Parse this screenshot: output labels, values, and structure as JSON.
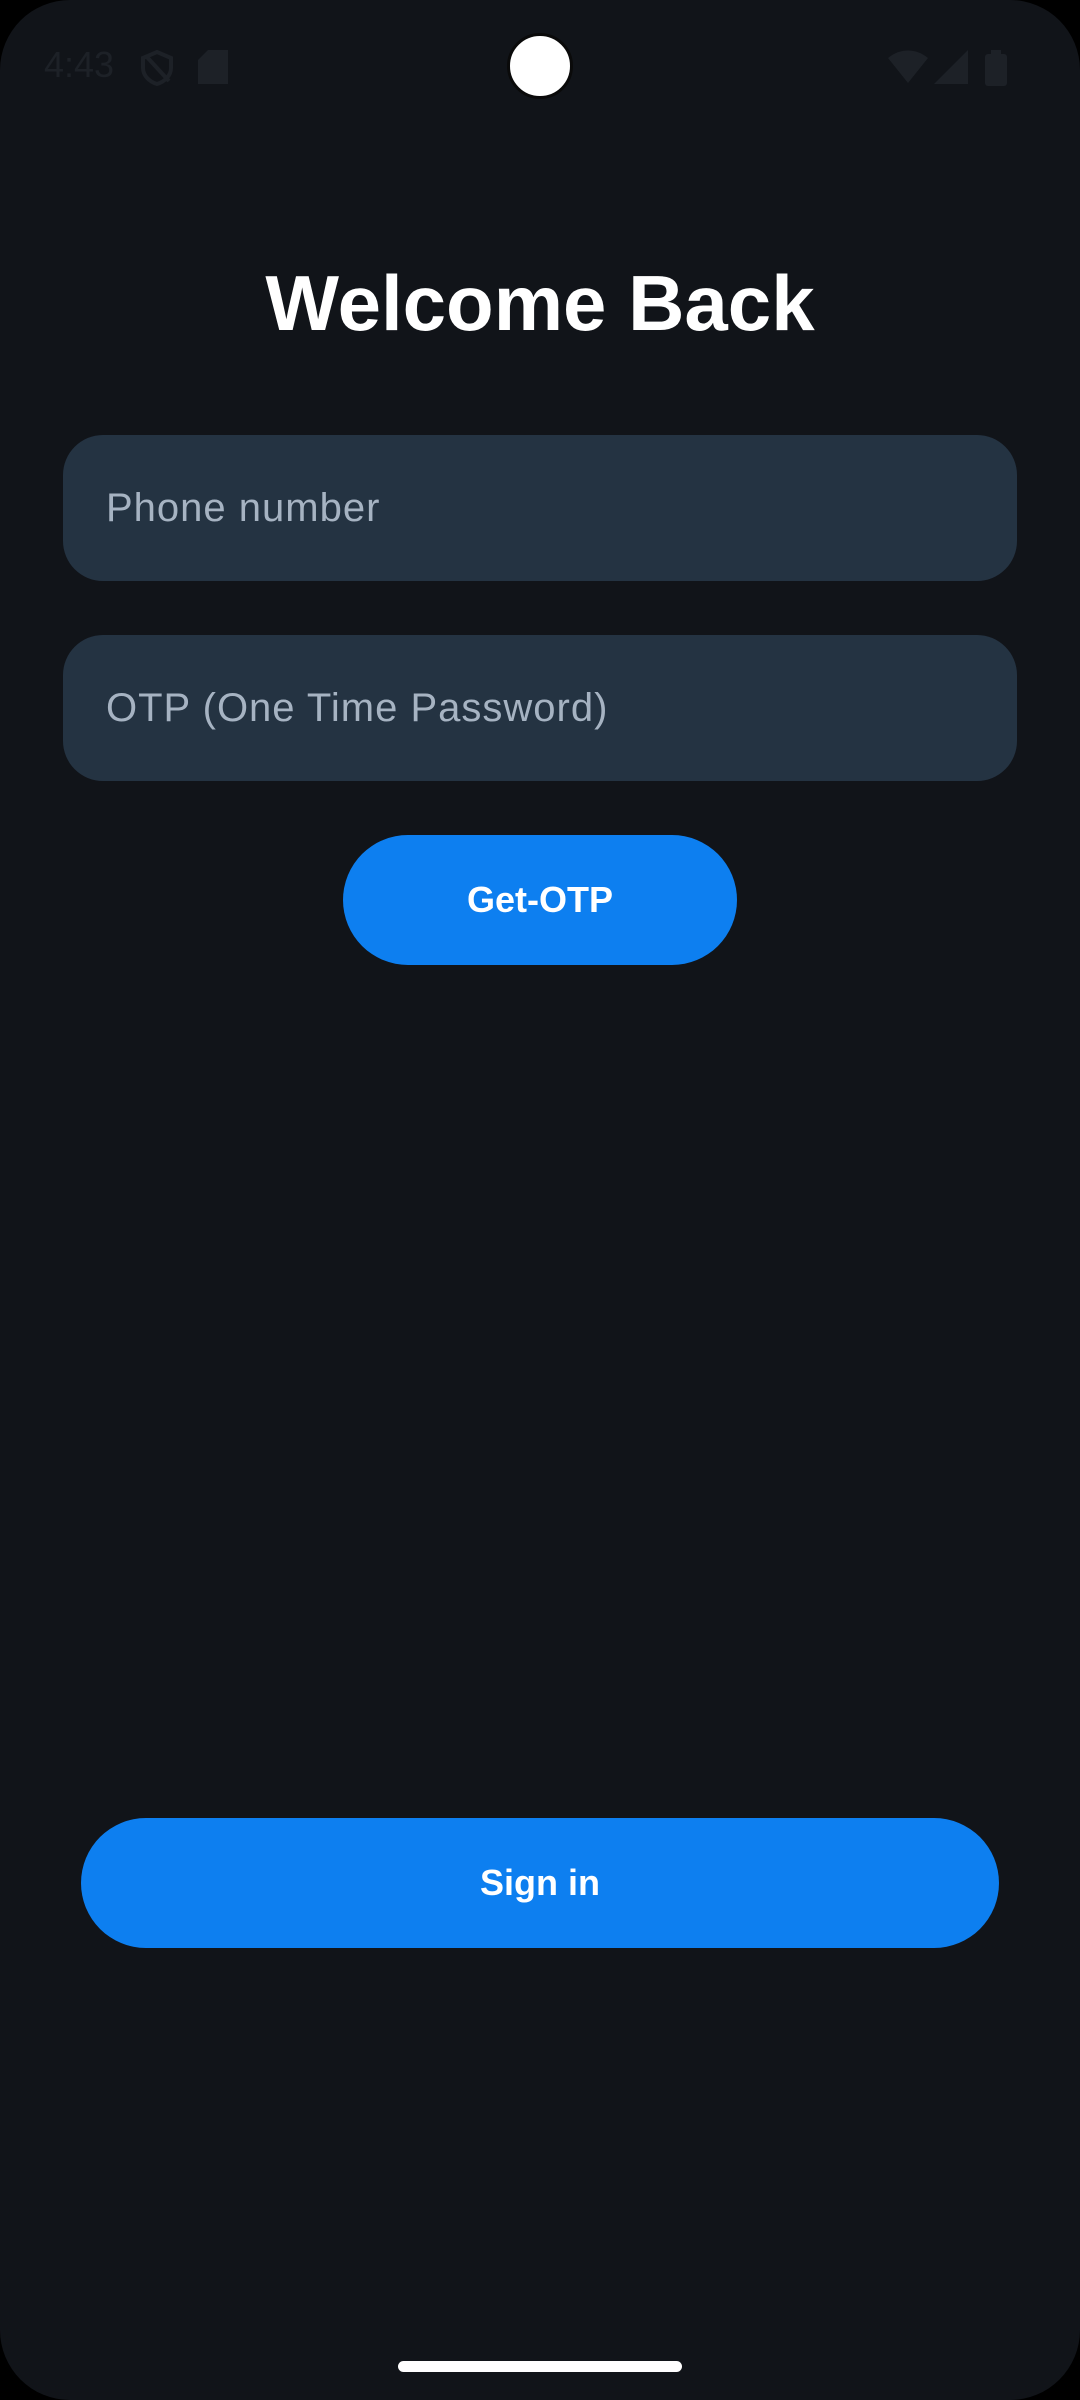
{
  "status_bar": {
    "time": "4:43",
    "left_icons": [
      "shield-icon",
      "sd-card-icon"
    ],
    "right_icons": [
      "wifi-icon",
      "signal-icon",
      "battery-icon"
    ]
  },
  "title": "Welcome Back",
  "form": {
    "phone": {
      "value": "",
      "placeholder": "Phone number"
    },
    "otp": {
      "value": "",
      "placeholder": "OTP (One Time Password)"
    },
    "get_otp_label": "Get-OTP",
    "sign_in_label": "Sign in"
  },
  "colors": {
    "background": "#111419",
    "field_background": "#243342",
    "accent": "#0d7ff0",
    "placeholder": "#a6b3c2"
  }
}
